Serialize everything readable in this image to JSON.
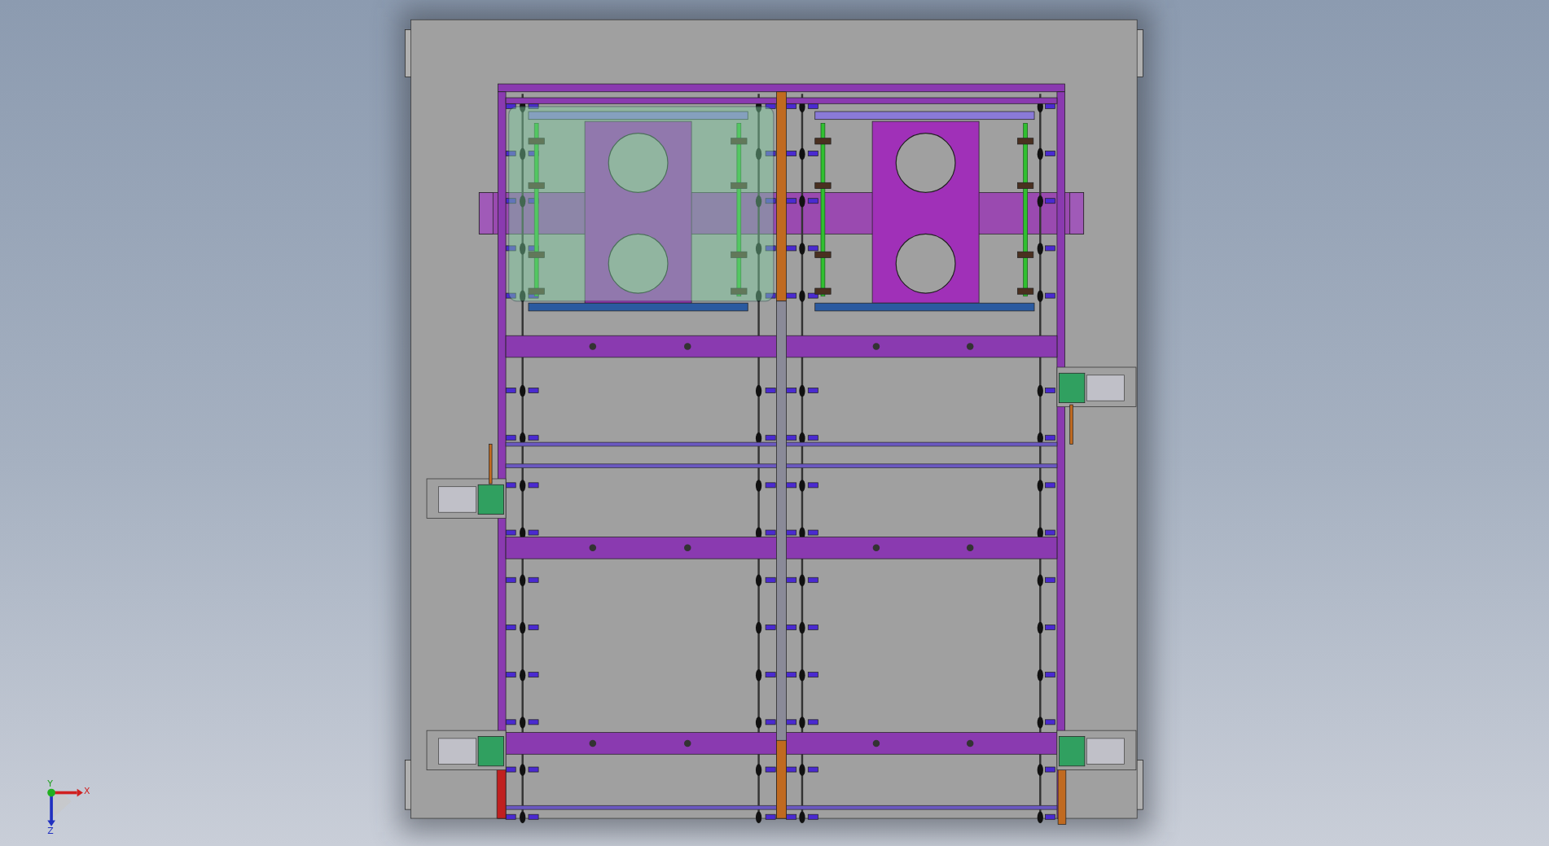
{
  "viewport": {
    "triad": {
      "x_label": "X",
      "y_label": "Y",
      "z_label": "Z"
    }
  }
}
